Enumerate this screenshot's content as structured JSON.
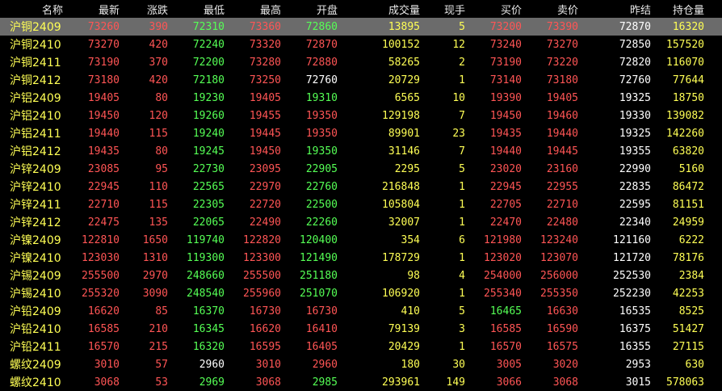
{
  "colors": {
    "background": "#000000",
    "header": "#e8e8e8",
    "name": "#ffff55",
    "up": "#ff5555",
    "down": "#55ff55",
    "neutral": "#ffffff",
    "volume": "#ffff55",
    "selected_row": "#6b6b6b"
  },
  "columns": [
    "名称",
    "最新",
    "涨跌",
    "最低",
    "最高",
    "开盘",
    "成交量",
    "现手",
    "买价",
    "卖价",
    "昨结",
    "持仓量"
  ],
  "rows": [
    {
      "name": "沪铜2409",
      "latest": "73260",
      "latest_c": "up",
      "change": "390",
      "change_c": "up",
      "low": "72310",
      "low_c": "down",
      "high": "73360",
      "high_c": "up",
      "open": "72860",
      "open_c": "down",
      "volume": "13895",
      "hand": "5",
      "bid": "73200",
      "bid_c": "up",
      "ask": "73390",
      "ask_c": "up",
      "prev": "72870",
      "oi": "16320",
      "selected": true
    },
    {
      "name": "沪铜2410",
      "latest": "73270",
      "latest_c": "up",
      "change": "420",
      "change_c": "up",
      "low": "72240",
      "low_c": "down",
      "high": "73320",
      "high_c": "up",
      "open": "72870",
      "open_c": "up",
      "volume": "100152",
      "hand": "12",
      "bid": "73240",
      "bid_c": "up",
      "ask": "73270",
      "ask_c": "up",
      "prev": "72850",
      "oi": "157520",
      "selected": false
    },
    {
      "name": "沪铜2411",
      "latest": "73190",
      "latest_c": "up",
      "change": "370",
      "change_c": "up",
      "low": "72200",
      "low_c": "down",
      "high": "73280",
      "high_c": "up",
      "open": "72880",
      "open_c": "up",
      "volume": "58265",
      "hand": "2",
      "bid": "73190",
      "bid_c": "up",
      "ask": "73220",
      "ask_c": "up",
      "prev": "72820",
      "oi": "116070",
      "selected": false
    },
    {
      "name": "沪铜2412",
      "latest": "73180",
      "latest_c": "up",
      "change": "420",
      "change_c": "up",
      "low": "72180",
      "low_c": "down",
      "high": "73250",
      "high_c": "up",
      "open": "72760",
      "open_c": "neutral",
      "volume": "20729",
      "hand": "1",
      "bid": "73140",
      "bid_c": "up",
      "ask": "73180",
      "ask_c": "up",
      "prev": "72760",
      "oi": "77644",
      "selected": false
    },
    {
      "name": "沪铝2409",
      "latest": "19405",
      "latest_c": "up",
      "change": "80",
      "change_c": "up",
      "low": "19230",
      "low_c": "down",
      "high": "19405",
      "high_c": "up",
      "open": "19310",
      "open_c": "down",
      "volume": "6565",
      "hand": "10",
      "bid": "19390",
      "bid_c": "up",
      "ask": "19405",
      "ask_c": "up",
      "prev": "19325",
      "oi": "18750",
      "selected": false
    },
    {
      "name": "沪铝2410",
      "latest": "19450",
      "latest_c": "up",
      "change": "120",
      "change_c": "up",
      "low": "19260",
      "low_c": "down",
      "high": "19455",
      "high_c": "up",
      "open": "19350",
      "open_c": "up",
      "volume": "129198",
      "hand": "7",
      "bid": "19450",
      "bid_c": "up",
      "ask": "19460",
      "ask_c": "up",
      "prev": "19330",
      "oi": "139082",
      "selected": false
    },
    {
      "name": "沪铝2411",
      "latest": "19440",
      "latest_c": "up",
      "change": "115",
      "change_c": "up",
      "low": "19240",
      "low_c": "down",
      "high": "19445",
      "high_c": "up",
      "open": "19350",
      "open_c": "up",
      "volume": "89901",
      "hand": "23",
      "bid": "19435",
      "bid_c": "up",
      "ask": "19440",
      "ask_c": "up",
      "prev": "19325",
      "oi": "142260",
      "selected": false
    },
    {
      "name": "沪铝2412",
      "latest": "19435",
      "latest_c": "up",
      "change": "80",
      "change_c": "up",
      "low": "19245",
      "low_c": "down",
      "high": "19450",
      "high_c": "up",
      "open": "19350",
      "open_c": "down",
      "volume": "31146",
      "hand": "7",
      "bid": "19440",
      "bid_c": "up",
      "ask": "19445",
      "ask_c": "up",
      "prev": "19355",
      "oi": "63820",
      "selected": false
    },
    {
      "name": "沪锌2409",
      "latest": "23085",
      "latest_c": "up",
      "change": "95",
      "change_c": "up",
      "low": "22730",
      "low_c": "down",
      "high": "23095",
      "high_c": "up",
      "open": "22905",
      "open_c": "down",
      "volume": "2295",
      "hand": "5",
      "bid": "23020",
      "bid_c": "up",
      "ask": "23160",
      "ask_c": "up",
      "prev": "22990",
      "oi": "5160",
      "selected": false
    },
    {
      "name": "沪锌2410",
      "latest": "22945",
      "latest_c": "up",
      "change": "110",
      "change_c": "up",
      "low": "22565",
      "low_c": "down",
      "high": "22970",
      "high_c": "up",
      "open": "22760",
      "open_c": "down",
      "volume": "216848",
      "hand": "1",
      "bid": "22945",
      "bid_c": "up",
      "ask": "22955",
      "ask_c": "up",
      "prev": "22835",
      "oi": "86472",
      "selected": false
    },
    {
      "name": "沪锌2411",
      "latest": "22710",
      "latest_c": "up",
      "change": "115",
      "change_c": "up",
      "low": "22305",
      "low_c": "down",
      "high": "22720",
      "high_c": "up",
      "open": "22500",
      "open_c": "down",
      "volume": "105804",
      "hand": "1",
      "bid": "22705",
      "bid_c": "up",
      "ask": "22710",
      "ask_c": "up",
      "prev": "22595",
      "oi": "81151",
      "selected": false
    },
    {
      "name": "沪锌2412",
      "latest": "22475",
      "latest_c": "up",
      "change": "135",
      "change_c": "up",
      "low": "22065",
      "low_c": "down",
      "high": "22490",
      "high_c": "up",
      "open": "22260",
      "open_c": "down",
      "volume": "32007",
      "hand": "1",
      "bid": "22470",
      "bid_c": "up",
      "ask": "22480",
      "ask_c": "up",
      "prev": "22340",
      "oi": "24959",
      "selected": false
    },
    {
      "name": "沪镍2409",
      "latest": "122810",
      "latest_c": "up",
      "change": "1650",
      "change_c": "up",
      "low": "119740",
      "low_c": "down",
      "high": "122820",
      "high_c": "up",
      "open": "120400",
      "open_c": "down",
      "volume": "354",
      "hand": "6",
      "bid": "121980",
      "bid_c": "up",
      "ask": "123240",
      "ask_c": "up",
      "prev": "121160",
      "oi": "6222",
      "selected": false
    },
    {
      "name": "沪镍2410",
      "latest": "123030",
      "latest_c": "up",
      "change": "1310",
      "change_c": "up",
      "low": "119300",
      "low_c": "down",
      "high": "123300",
      "high_c": "up",
      "open": "121490",
      "open_c": "down",
      "volume": "178729",
      "hand": "1",
      "bid": "123020",
      "bid_c": "up",
      "ask": "123070",
      "ask_c": "up",
      "prev": "121720",
      "oi": "78176",
      "selected": false
    },
    {
      "name": "沪锡2409",
      "latest": "255500",
      "latest_c": "up",
      "change": "2970",
      "change_c": "up",
      "low": "248660",
      "low_c": "down",
      "high": "255500",
      "high_c": "up",
      "open": "251180",
      "open_c": "down",
      "volume": "98",
      "hand": "4",
      "bid": "254000",
      "bid_c": "up",
      "ask": "256000",
      "ask_c": "up",
      "prev": "252530",
      "oi": "2384",
      "selected": false
    },
    {
      "name": "沪锡2410",
      "latest": "255320",
      "latest_c": "up",
      "change": "3090",
      "change_c": "up",
      "low": "248540",
      "low_c": "down",
      "high": "255960",
      "high_c": "up",
      "open": "251070",
      "open_c": "down",
      "volume": "106920",
      "hand": "1",
      "bid": "255340",
      "bid_c": "up",
      "ask": "255350",
      "ask_c": "up",
      "prev": "252230",
      "oi": "42253",
      "selected": false
    },
    {
      "name": "沪铅2409",
      "latest": "16620",
      "latest_c": "up",
      "change": "85",
      "change_c": "up",
      "low": "16370",
      "low_c": "down",
      "high": "16730",
      "high_c": "up",
      "open": "16730",
      "open_c": "up",
      "volume": "410",
      "hand": "5",
      "bid": "16465",
      "bid_c": "down",
      "ask": "16630",
      "ask_c": "up",
      "prev": "16535",
      "oi": "8525",
      "selected": false
    },
    {
      "name": "沪铅2410",
      "latest": "16585",
      "latest_c": "up",
      "change": "210",
      "change_c": "up",
      "low": "16345",
      "low_c": "down",
      "high": "16620",
      "high_c": "up",
      "open": "16410",
      "open_c": "up",
      "volume": "79139",
      "hand": "3",
      "bid": "16585",
      "bid_c": "up",
      "ask": "16590",
      "ask_c": "up",
      "prev": "16375",
      "oi": "51427",
      "selected": false
    },
    {
      "name": "沪铅2411",
      "latest": "16570",
      "latest_c": "up",
      "change": "215",
      "change_c": "up",
      "low": "16320",
      "low_c": "down",
      "high": "16595",
      "high_c": "up",
      "open": "16405",
      "open_c": "up",
      "volume": "20429",
      "hand": "1",
      "bid": "16570",
      "bid_c": "up",
      "ask": "16575",
      "ask_c": "up",
      "prev": "16355",
      "oi": "27115",
      "selected": false
    },
    {
      "name": "螺纹2409",
      "latest": "3010",
      "latest_c": "up",
      "change": "57",
      "change_c": "up",
      "low": "2960",
      "low_c": "neutral",
      "high": "3010",
      "high_c": "up",
      "open": "2960",
      "open_c": "up",
      "volume": "180",
      "hand": "30",
      "bid": "3005",
      "bid_c": "up",
      "ask": "3020",
      "ask_c": "up",
      "prev": "2953",
      "oi": "630",
      "selected": false
    },
    {
      "name": "螺纹2410",
      "latest": "3068",
      "latest_c": "up",
      "change": "53",
      "change_c": "up",
      "low": "2969",
      "low_c": "down",
      "high": "3068",
      "high_c": "up",
      "open": "2985",
      "open_c": "down",
      "volume": "293961",
      "hand": "149",
      "bid": "3066",
      "bid_c": "up",
      "ask": "3068",
      "ask_c": "up",
      "prev": "3015",
      "oi": "578063",
      "selected": false
    }
  ]
}
